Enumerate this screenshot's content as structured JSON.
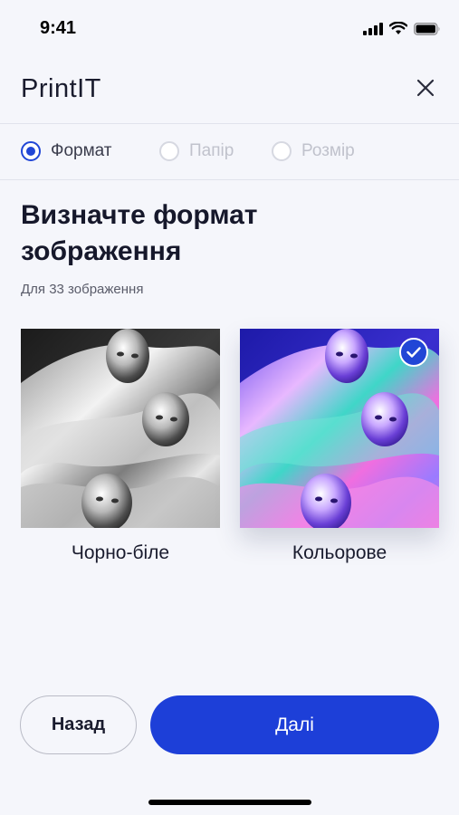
{
  "status_bar": {
    "time": "9:41"
  },
  "header": {
    "title": "PrintIT",
    "close_icon": "close-icon"
  },
  "steps": [
    {
      "label": "Формат",
      "active": true
    },
    {
      "label": "Папір",
      "active": false
    },
    {
      "label": "Розмір",
      "active": false
    }
  ],
  "main": {
    "heading": "Визначте формат зображення",
    "subheading": "Для 33 зображення",
    "options": [
      {
        "label": "Чорно-біле",
        "selected": false
      },
      {
        "label": "Кольорове",
        "selected": true
      }
    ]
  },
  "footer": {
    "back_label": "Назад",
    "next_label": "Далі"
  },
  "colors": {
    "accent": "#1d3fd8",
    "background": "#f5f6fb",
    "text": "#16182b"
  }
}
